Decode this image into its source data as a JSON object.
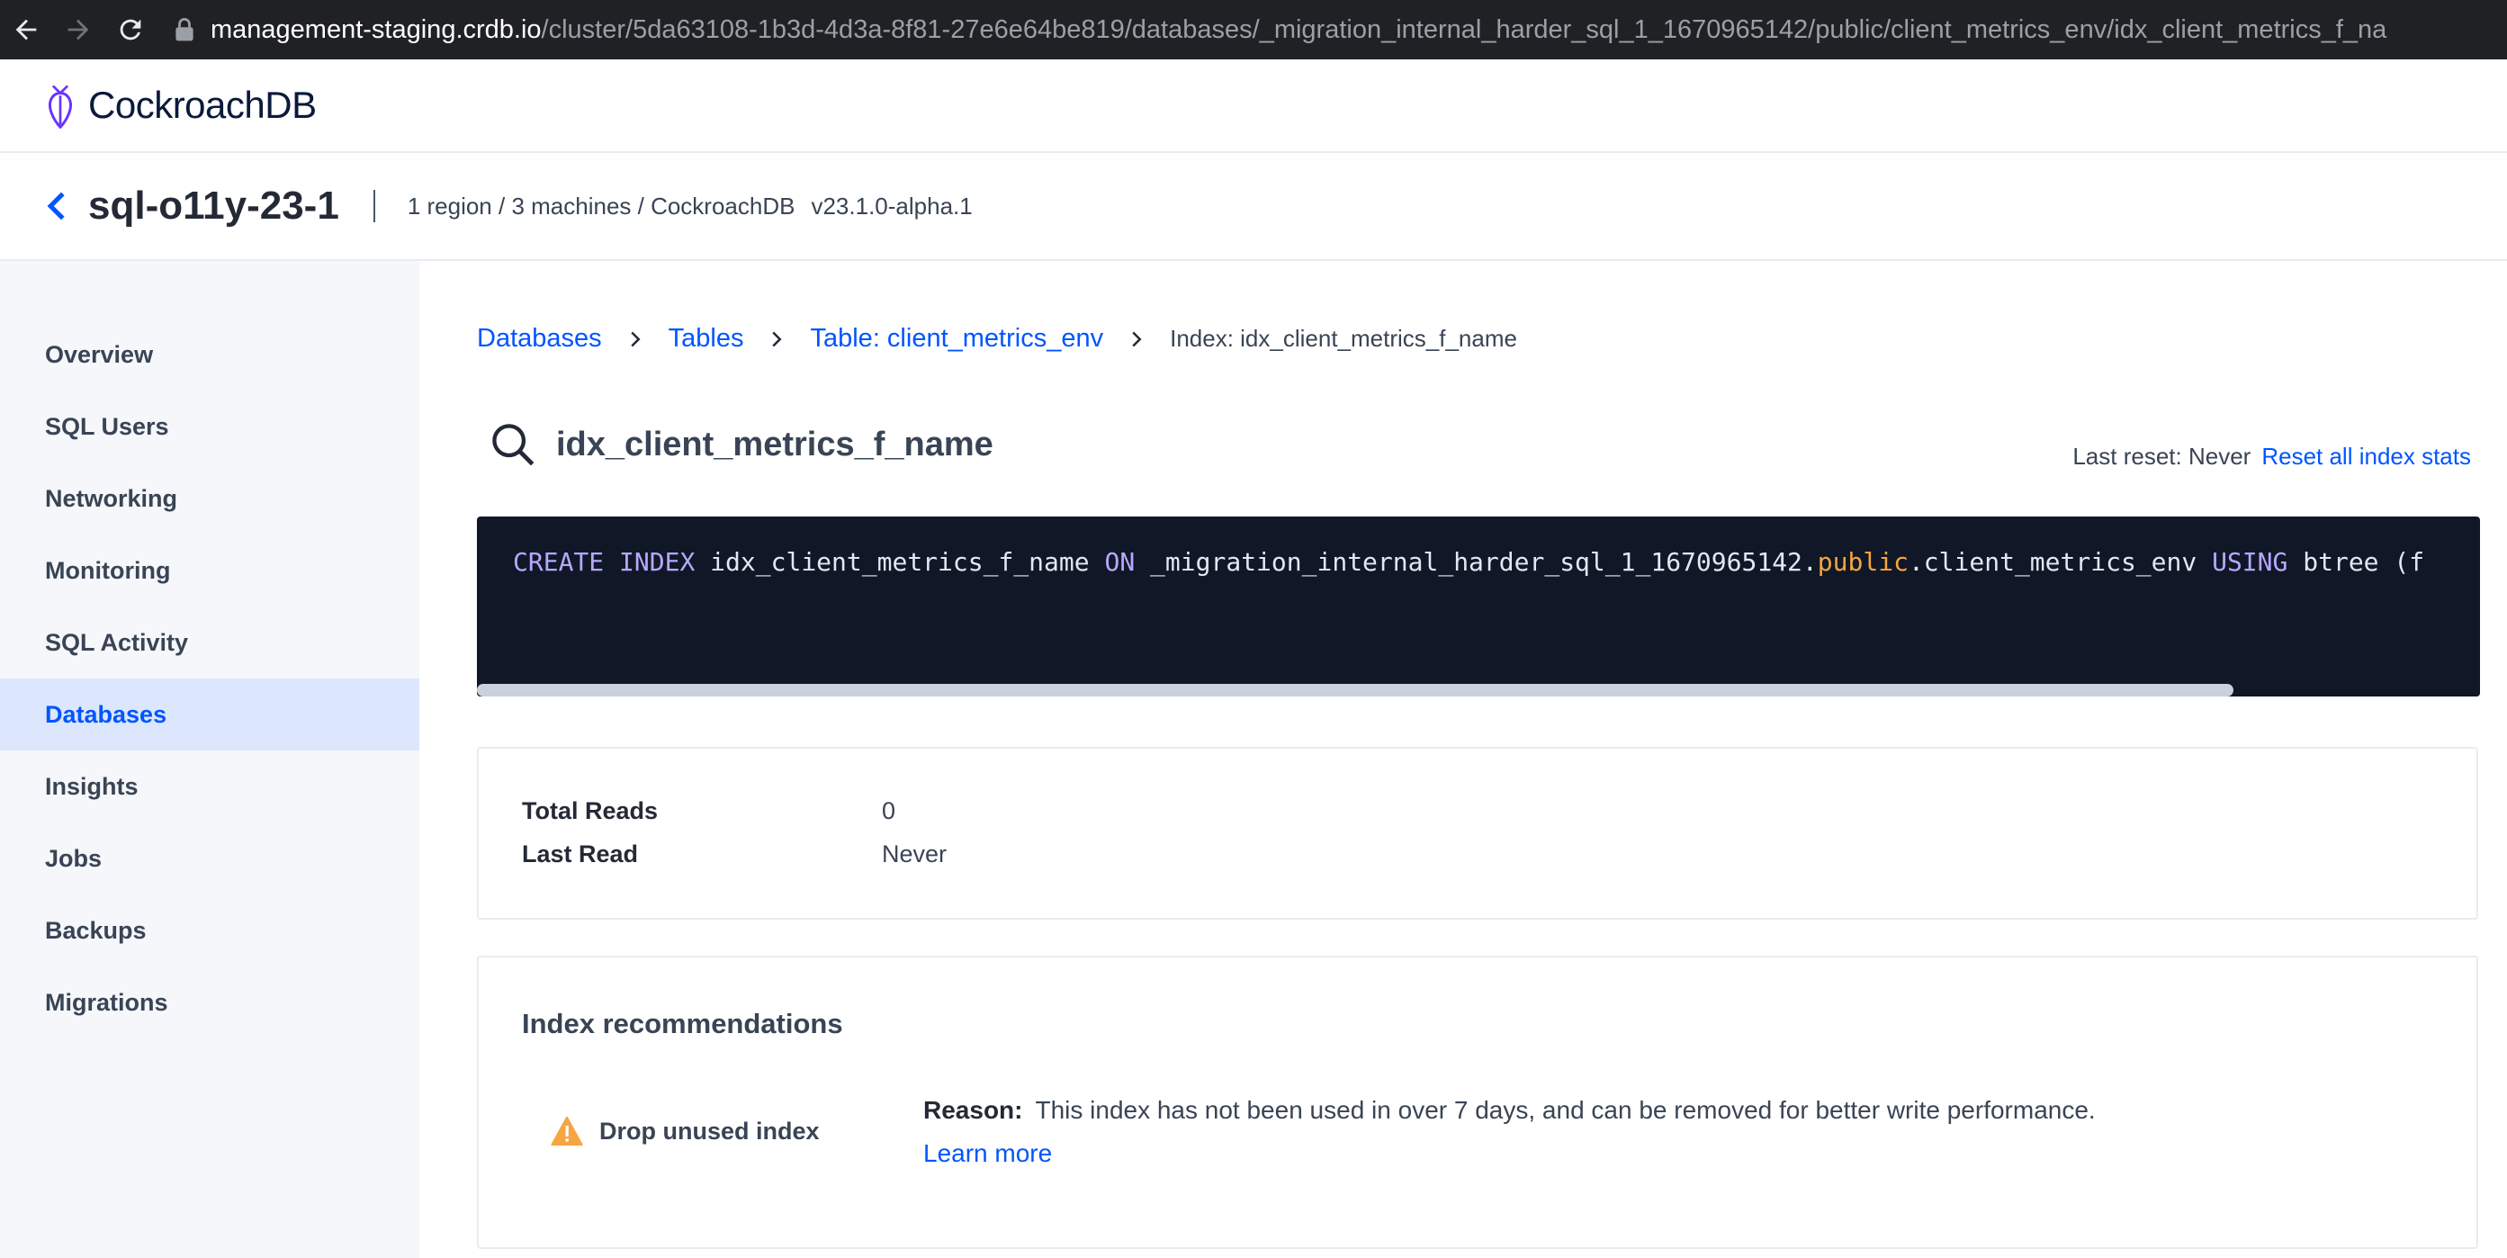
{
  "browser": {
    "url_host": "management-staging.crdb.io",
    "url_path": "/cluster/5da63108-1b3d-4d3a-8f81-27e6e64be819/databases/_migration_internal_harder_sql_1_1670965142/public/client_metrics_env/idx_client_metrics_f_na"
  },
  "app": {
    "logo_text": "CockroachDB"
  },
  "cluster": {
    "name": "sql-o11y-23-1",
    "meta": "1 region / 3 machines / CockroachDB",
    "version": "v23.1.0-alpha.1"
  },
  "sidebar": {
    "items": [
      {
        "label": "Overview"
      },
      {
        "label": "SQL Users"
      },
      {
        "label": "Networking"
      },
      {
        "label": "Monitoring"
      },
      {
        "label": "SQL Activity"
      },
      {
        "label": "Databases",
        "active": true
      },
      {
        "label": "Insights"
      },
      {
        "label": "Jobs"
      },
      {
        "label": "Backups"
      },
      {
        "label": "Migrations"
      }
    ]
  },
  "breadcrumb": {
    "items": [
      "Databases",
      "Tables",
      "Table: client_metrics_env"
    ],
    "current": "Index: idx_client_metrics_f_name"
  },
  "page": {
    "title": "idx_client_metrics_f_name",
    "last_reset_label": "Last reset: Never",
    "reset_link": "Reset all index stats"
  },
  "code": {
    "kw_create": "CREATE",
    "kw_index": "INDEX",
    "index_name": "idx_client_metrics_f_name",
    "kw_on": "ON",
    "db_name": "_migration_internal_harder_sql_1_1670965142.",
    "schema": "public",
    "table": ".client_metrics_env",
    "kw_using": "USING",
    "tail": "btree (f"
  },
  "stats": {
    "total_reads_label": "Total Reads",
    "total_reads_value": "0",
    "last_read_label": "Last Read",
    "last_read_value": "Never"
  },
  "recommendations": {
    "title": "Index recommendations",
    "type_label": "Drop unused index",
    "reason_label": "Reason:",
    "reason_text": "This index has not been used in over 7 days, and can be removed for better write performance.",
    "learn_more": "Learn more"
  },
  "colors": {
    "accent": "#0055ff",
    "warning": "#f7a541",
    "code_bg": "#101726"
  }
}
